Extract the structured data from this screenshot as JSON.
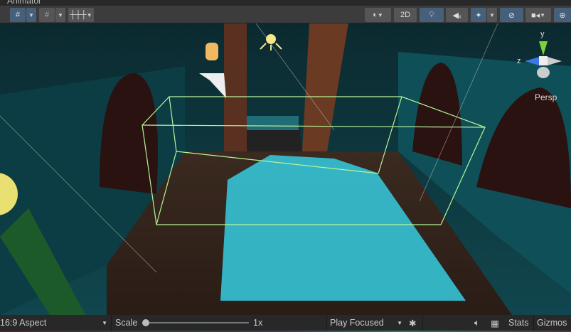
{
  "window": {
    "tab_title": "Animator"
  },
  "toolbar": {
    "left": [
      {
        "icon": "grid-snap-icon",
        "active": true
      },
      {
        "icon": "increment-snap-icon",
        "active": false
      },
      {
        "icon": "ruler-icon",
        "active": false
      }
    ],
    "right": {
      "shading_icon": "sphere-shading-icon",
      "mode_2d": "2D",
      "lighting_icon": "lightbulb-icon",
      "audio_icon": "audio-mute-icon",
      "effects_icon": "effects-icon",
      "visibility_icon": "hidden-eye-icon",
      "camera_icon": "camera-icon",
      "gizmo_icon": "gizmo-globe-icon"
    }
  },
  "scene": {
    "orientation_gizmo": {
      "y": "y",
      "z": "z",
      "projection": "Persp"
    },
    "colors": {
      "wireframe": "#b8f59a",
      "water": "#35c3d6",
      "wall": "#0f4a52"
    }
  },
  "gameview_bar": {
    "aspect": "16:9 Aspect",
    "scale_label": "Scale",
    "scale_value": "1x",
    "scale_fraction": 0,
    "play_mode": "Play Focused",
    "stats": "Stats",
    "gizmos": "Gizmos"
  }
}
